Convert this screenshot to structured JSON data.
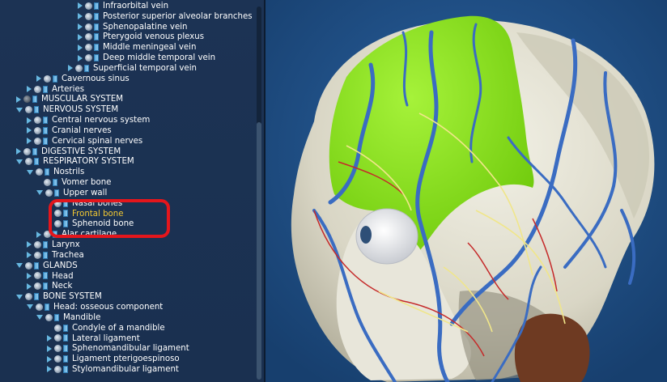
{
  "tree": {
    "items": [
      {
        "label": "Infraorbital vein",
        "indent": 96,
        "arrow": "collapsed",
        "eye": "light",
        "selected": false
      },
      {
        "label": "Posterior superior alveolar branches",
        "indent": 96,
        "arrow": "collapsed",
        "eye": "light",
        "selected": false
      },
      {
        "label": "Sphenopalatine vein",
        "indent": 96,
        "arrow": "collapsed",
        "eye": "light",
        "selected": false
      },
      {
        "label": "Pterygoid venous plexus",
        "indent": 96,
        "arrow": "collapsed",
        "eye": "light",
        "selected": false
      },
      {
        "label": "Middle meningeal vein",
        "indent": 96,
        "arrow": "collapsed",
        "eye": "light",
        "selected": false
      },
      {
        "label": "Deep middle temporal vein",
        "indent": 96,
        "arrow": "collapsed",
        "eye": "light",
        "selected": false
      },
      {
        "label": "Superficial temporal vein",
        "indent": 84,
        "arrow": "collapsed",
        "eye": "light",
        "selected": false
      },
      {
        "label": "Cavernous sinus",
        "indent": 45,
        "arrow": "collapsed",
        "eye": "light",
        "selected": false
      },
      {
        "label": "Arteries",
        "indent": 33,
        "arrow": "collapsed",
        "eye": "light",
        "selected": false
      },
      {
        "label": "MUSCULAR SYSTEM",
        "indent": 20,
        "arrow": "collapsed",
        "eye": "dark",
        "selected": false
      },
      {
        "label": "NERVOUS SYSTEM",
        "indent": 20,
        "arrow": "expanded",
        "eye": "light",
        "selected": false
      },
      {
        "label": "Central nervous system",
        "indent": 33,
        "arrow": "collapsed",
        "eye": "light",
        "selected": false
      },
      {
        "label": "Cranial nerves",
        "indent": 33,
        "arrow": "collapsed",
        "eye": "light",
        "selected": false
      },
      {
        "label": "Cervical spinal nerves",
        "indent": 33,
        "arrow": "collapsed",
        "eye": "light",
        "selected": false
      },
      {
        "label": "DIGESTIVE SYSTEM",
        "indent": 20,
        "arrow": "collapsed",
        "eye": "light",
        "selected": false
      },
      {
        "label": "RESPIRATORY SYSTEM",
        "indent": 20,
        "arrow": "expanded",
        "eye": "light",
        "selected": false
      },
      {
        "label": "Nostrils",
        "indent": 33,
        "arrow": "expanded",
        "eye": "light",
        "selected": false
      },
      {
        "label": "Vomer bone",
        "indent": 45,
        "arrow": "none",
        "eye": "light",
        "selected": false
      },
      {
        "label": "Upper wall",
        "indent": 45,
        "arrow": "expanded",
        "eye": "light",
        "selected": false
      },
      {
        "label": "Nasal bones",
        "indent": 58,
        "arrow": "none",
        "eye": "light",
        "selected": false
      },
      {
        "label": "Frontal bone",
        "indent": 58,
        "arrow": "none",
        "eye": "light",
        "selected": true
      },
      {
        "label": "Sphenoid bone",
        "indent": 58,
        "arrow": "none",
        "eye": "light",
        "selected": false
      },
      {
        "label": "Alar cartilage",
        "indent": 45,
        "arrow": "collapsed",
        "eye": "light",
        "selected": false
      },
      {
        "label": "Larynx",
        "indent": 33,
        "arrow": "collapsed",
        "eye": "light",
        "selected": false
      },
      {
        "label": "Trachea",
        "indent": 33,
        "arrow": "collapsed",
        "eye": "light",
        "selected": false
      },
      {
        "label": "GLANDS",
        "indent": 20,
        "arrow": "expanded",
        "eye": "light",
        "selected": false
      },
      {
        "label": "Head",
        "indent": 33,
        "arrow": "collapsed",
        "eye": "light",
        "selected": false
      },
      {
        "label": "Neck",
        "indent": 33,
        "arrow": "collapsed",
        "eye": "light",
        "selected": false
      },
      {
        "label": "BONE SYSTEM",
        "indent": 20,
        "arrow": "expanded",
        "eye": "light",
        "selected": false
      },
      {
        "label": "Head: osseous component",
        "indent": 33,
        "arrow": "expanded",
        "eye": "light",
        "selected": false
      },
      {
        "label": "Mandible",
        "indent": 45,
        "arrow": "expanded",
        "eye": "light",
        "selected": false
      },
      {
        "label": "Condyle of a mandible",
        "indent": 58,
        "arrow": "none",
        "eye": "light",
        "selected": false
      },
      {
        "label": "Lateral ligament",
        "indent": 58,
        "arrow": "collapsed",
        "eye": "light",
        "selected": false
      },
      {
        "label": "Sphenomandibular ligament",
        "indent": 58,
        "arrow": "collapsed",
        "eye": "light",
        "selected": false
      },
      {
        "label": "Ligament pterigoespinoso",
        "indent": 58,
        "arrow": "collapsed",
        "eye": "light",
        "selected": false
      },
      {
        "label": "Stylomandibular ligament",
        "indent": 58,
        "arrow": "collapsed",
        "eye": "light",
        "selected": false
      }
    ]
  },
  "colors": {
    "panel_bg": "#1c3354",
    "viewport_bg": "#1e4f86",
    "selected_text": "#f2c832",
    "highlight_box": "#e4161c",
    "frontal_bone": "#8ee61c",
    "skull_bone": "#e7e5d8",
    "veins": "#3a6cc2",
    "nerves": "#f0e68a",
    "arteries": "#c52a2a"
  }
}
